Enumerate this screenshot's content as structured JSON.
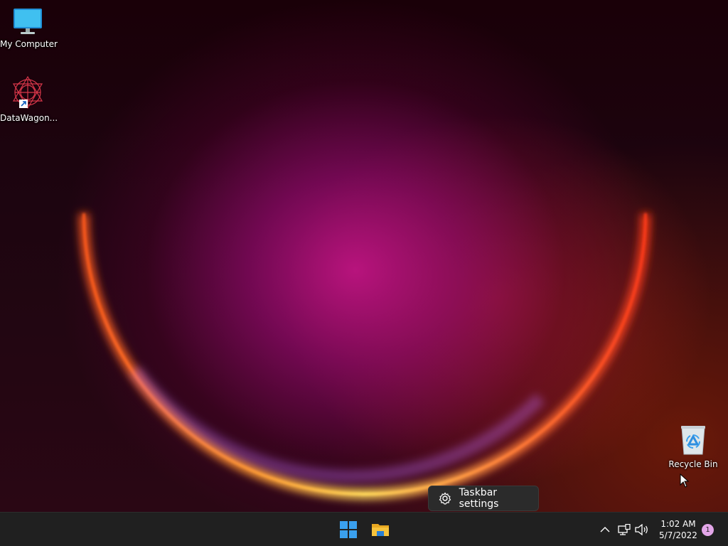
{
  "desktop": {
    "icons": [
      {
        "label": "My Computer",
        "icon": "monitor-icon"
      },
      {
        "label": "DataWagon...",
        "icon": "datawagon-app-icon",
        "shortcut": true
      },
      {
        "label": "Recycle Bin",
        "icon": "recycle-bin-icon"
      }
    ]
  },
  "tooltip": {
    "label": "Taskbar settings",
    "icon": "gear-icon"
  },
  "taskbar": {
    "pinned": [
      {
        "name": "Start",
        "icon": "windows-logo-icon"
      },
      {
        "name": "File Explorer",
        "icon": "folder-icon"
      }
    ],
    "tray": {
      "icons": [
        "chevron-up-icon",
        "network-icon",
        "volume-icon"
      ],
      "time": "1:02 AM",
      "date": "5/7/2022",
      "notification_count": "1"
    }
  },
  "colors": {
    "taskbar_bg": "#202020",
    "start_blue": "#3aa0ee",
    "folder_yellow": "#f7c33c",
    "notif_badge": "#e3a6e8"
  }
}
